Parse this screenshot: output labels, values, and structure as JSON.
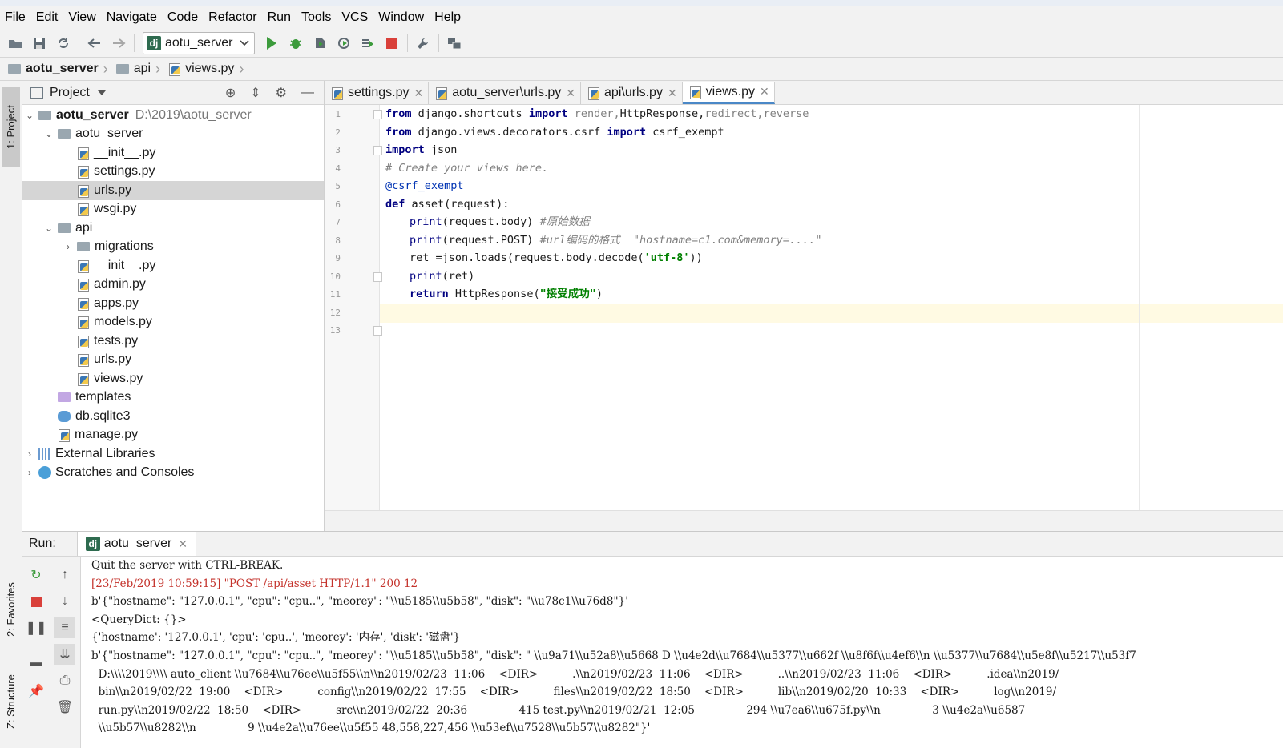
{
  "menu": [
    "File",
    "Edit",
    "View",
    "Navigate",
    "Code",
    "Refactor",
    "Run",
    "Tools",
    "VCS",
    "Window",
    "Help"
  ],
  "toolbar": {
    "run_config": "aotu_server"
  },
  "breadcrumbs": [
    "aotu_server",
    "api",
    "views.py"
  ],
  "sidebar_tabs": {
    "project": "1: Project",
    "favorites": "2: Favorites",
    "structure": "Z: Structure"
  },
  "project_panel": {
    "title": "Project",
    "root": {
      "name": "aotu_server",
      "path": "D:\\2019\\aotu_server"
    },
    "items": [
      {
        "label": "aotu_server",
        "type": "package",
        "depth": 1,
        "expanded": true
      },
      {
        "label": "__init__.py",
        "type": "py",
        "depth": 2
      },
      {
        "label": "settings.py",
        "type": "py",
        "depth": 2
      },
      {
        "label": "urls.py",
        "type": "py",
        "depth": 2,
        "selected": true
      },
      {
        "label": "wsgi.py",
        "type": "py",
        "depth": 2
      },
      {
        "label": "api",
        "type": "package",
        "depth": 1,
        "expanded": true
      },
      {
        "label": "migrations",
        "type": "package",
        "depth": 2,
        "expanded": false
      },
      {
        "label": "__init__.py",
        "type": "py",
        "depth": 2
      },
      {
        "label": "admin.py",
        "type": "py",
        "depth": 2
      },
      {
        "label": "apps.py",
        "type": "py",
        "depth": 2
      },
      {
        "label": "models.py",
        "type": "py",
        "depth": 2
      },
      {
        "label": "tests.py",
        "type": "py",
        "depth": 2
      },
      {
        "label": "urls.py",
        "type": "py",
        "depth": 2
      },
      {
        "label": "views.py",
        "type": "py",
        "depth": 2
      },
      {
        "label": "templates",
        "type": "template-folder",
        "depth": 1
      },
      {
        "label": "db.sqlite3",
        "type": "db",
        "depth": 1
      },
      {
        "label": "manage.py",
        "type": "py",
        "depth": 1
      }
    ],
    "extra": [
      "External Libraries",
      "Scratches and Consoles"
    ]
  },
  "editor_tabs": [
    {
      "label": "settings.py",
      "active": false
    },
    {
      "label": "aotu_server\\urls.py",
      "active": false
    },
    {
      "label": "api\\urls.py",
      "active": false
    },
    {
      "label": "views.py",
      "active": true
    }
  ],
  "code_lines": [
    "1",
    "2",
    "3",
    "4",
    "5",
    "6",
    "7",
    "8",
    "9",
    "10",
    "11",
    "12",
    "13"
  ],
  "code": {
    "l1": [
      "from",
      " django.shortcuts ",
      "import",
      " render,",
      "HttpResponse,",
      "redirect,",
      "reverse"
    ],
    "l2": [
      "from",
      " django.views.decorators.csrf ",
      "import",
      " csrf_exempt"
    ],
    "l3": [
      "import",
      " json"
    ],
    "l4": "# Create your views here.",
    "l5": "@csrf_exempt",
    "l6": [
      "def",
      " asset(request):"
    ],
    "l7": [
      "print",
      "(request.body) ",
      "#原始数据"
    ],
    "l8": [
      "print",
      "(request.POST) ",
      "#url编码的格式  \"hostname=c1.com&memory=....\""
    ],
    "l9": [
      "ret =json.loads(request.body.decode(",
      "'utf-8'",
      "))"
    ],
    "l10": [
      "print",
      "(ret)"
    ],
    "l11": [
      "return",
      " HttpResponse(",
      "\"接受成功\"",
      ")"
    ]
  },
  "run_panel": {
    "label": "Run:",
    "tab": "aotu_server",
    "console": [
      {
        "text": "Quit the server with CTRL-BREAK.",
        "color": "normal"
      },
      {
        "text": "[23/Feb/2019 10:59:15] \"POST /api/asset HTTP/1.1\" 200 12",
        "color": "red"
      },
      {
        "text": "b'{\"hostname\": \"127.0.0.1\", \"cpu\": \"cpu..\", \"meorey\": \"\\\\u5185\\\\u5b58\", \"disk\": \"\\\\u78c1\\\\u76d8\"}'",
        "color": "normal"
      },
      {
        "text": "<QueryDict: {}>",
        "color": "normal"
      },
      {
        "text": "{'hostname': '127.0.0.1', 'cpu': 'cpu..', 'meorey': '内存', 'disk': '磁盘'}",
        "color": "normal"
      },
      {
        "text": "b'{\"hostname\": \"127.0.0.1\", \"cpu\": \"cpu..\", \"meorey\": \"\\\\u5185\\\\u5b58\", \"disk\": \" \\\\u9a71\\\\u52a8\\\\u5668 D \\\\u4e2d\\\\u7684\\\\u5377\\\\u662f \\\\u8f6f\\\\u4ef6\\\\n \\\\u5377\\\\u7684\\\\u5e8f\\\\u5217\\\\u53f7",
        "color": "normal"
      },
      {
        "text": "  D:\\\\\\\\2019\\\\\\\\ auto_client \\\\u7684\\\\u76ee\\\\u5f55\\\\n\\\\n2019/02/23  11:06    <DIR>          .\\\\n2019/02/23  11:06    <DIR>          ..\\\\n2019/02/23  11:06    <DIR>          .idea\\\\n2019/",
        "color": "normal"
      },
      {
        "text": "  bin\\\\n2019/02/22  19:00    <DIR>          config\\\\n2019/02/22  17:55    <DIR>          files\\\\n2019/02/22  18:50    <DIR>          lib\\\\n2019/02/20  10:33    <DIR>          log\\\\n2019/",
        "color": "normal"
      },
      {
        "text": "  run.py\\\\n2019/02/22  18:50    <DIR>          src\\\\n2019/02/22  20:36               415 test.py\\\\n2019/02/21  12:05               294 \\\\u7ea6\\\\u675f.py\\\\n               3 \\\\u4e2a\\\\u6587",
        "color": "normal"
      },
      {
        "text": "  \\\\u5b57\\\\u8282\\\\n               9 \\\\u4e2a\\\\u76ee\\\\u5f55 48,558,227,456 \\\\u53ef\\\\u7528\\\\u5b57\\\\u8282\"}'",
        "color": "normal"
      }
    ]
  }
}
